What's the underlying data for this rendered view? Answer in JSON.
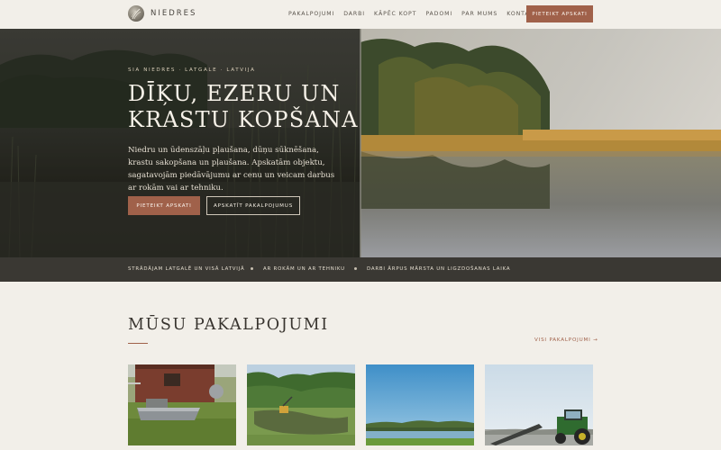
{
  "header": {
    "logo_text": "NIEDRES",
    "nav": [
      "PAKALPOJUMI",
      "DARBI",
      "KĀPĒC KOPT",
      "PADOMI",
      "PAR MUMS",
      "KONTAKTI"
    ],
    "cta_label": "PIETEIKT APSKATI"
  },
  "hero": {
    "eyebrow": "SIA NIEDRES · LATGALE · LATVIJA",
    "title_line1": "DĪĶU, EZERU UN",
    "title_line2": "KRASTU KOPŠANA",
    "description": "Niedru un ūdenszāļu pļaušana, dūņu sūknēšana, krastu sakopšana un pļaušana. Apskatām objektu, sagatavojām piedāvājumu ar cenu un veicam darbus ar rokām vai ar tehniku.",
    "primary_button": "PIETEIKT APSKATI",
    "secondary_button": "APSKATĪT PAKALPOJUMUS"
  },
  "strip": {
    "items": [
      "STRĀDĀJAM LATGALĒ UN VISĀ LATVIJĀ",
      "AR ROKĀM UN AR TEHNIKU",
      "DARBI ĀRPUS MĀRSTA UN LIGZDOŠANAS LAIKA"
    ]
  },
  "services": {
    "title": "MŪSU PAKALPOJUMI",
    "all_link": "VISI PAKALPOJUMI →",
    "cards": [
      {
        "image": "boat-with-equipment-on-grass"
      },
      {
        "image": "pond-with-excavator"
      },
      {
        "image": "lake-shore-blue-sky"
      },
      {
        "image": "tractor-with-mower"
      }
    ]
  },
  "colors": {
    "background": "#f2efe9",
    "accent": "#a0614a",
    "strip": "#3a3833",
    "text_dark": "#38342f"
  }
}
